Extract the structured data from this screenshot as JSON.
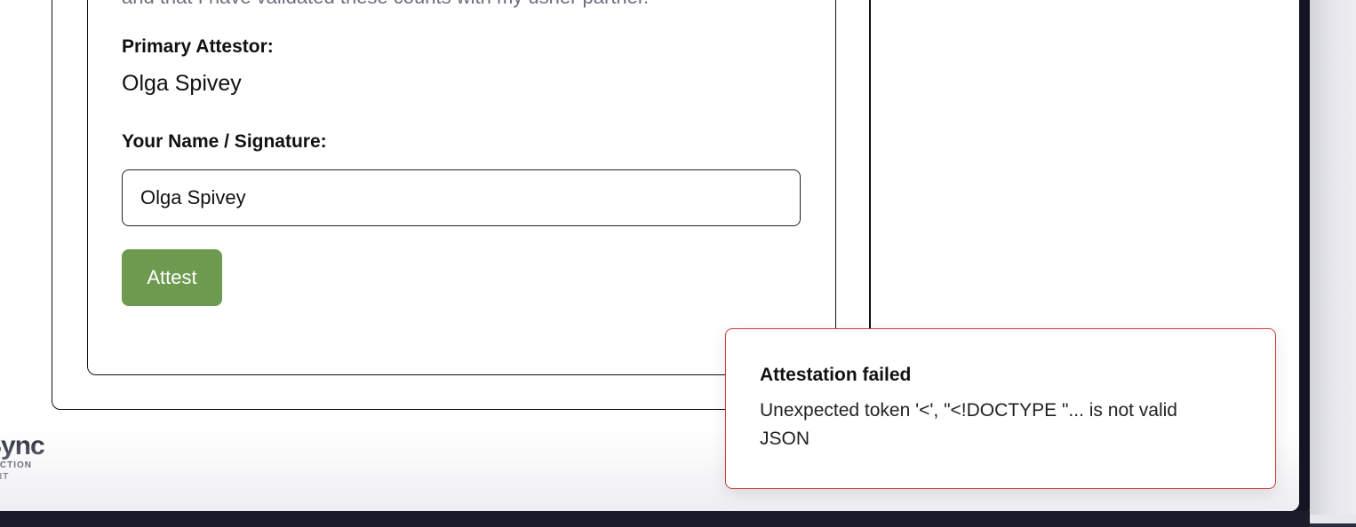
{
  "form": {
    "cut_off_text": "and that I have validated these counts with my usher partner.",
    "primary_attestor_label": "Primary Attestor:",
    "primary_attestor_value": "Olga Spivey",
    "signature_label": "Your Name / Signature:",
    "signature_value": "Olga Spivey",
    "attest_button": "Attest"
  },
  "logo": {
    "main": "Sync",
    "sub1": "LLECTION",
    "sub2": "MENT"
  },
  "toast": {
    "title": "Attestation failed",
    "message": "Unexpected token '<', \"<!DOCTYPE \"... is not valid JSON",
    "border_color": "#d13a3a"
  },
  "colors": {
    "attest_button": "#6d9a4e",
    "frame_dark": "#141522"
  }
}
